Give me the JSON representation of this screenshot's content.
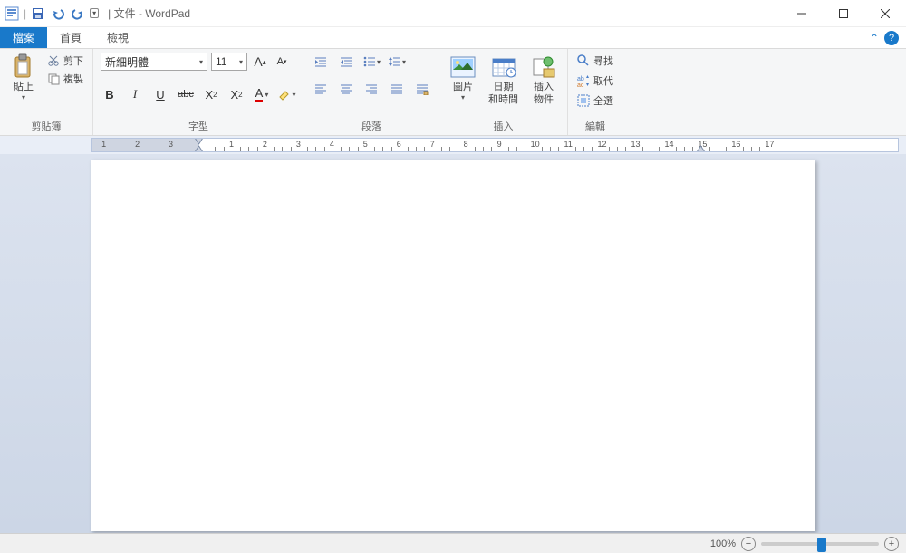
{
  "window": {
    "title": "文件 - WordPad",
    "separator": "|"
  },
  "tabs": {
    "file": "檔案",
    "home": "首頁",
    "view": "檢視"
  },
  "ribbon": {
    "clipboard": {
      "paste": "貼上",
      "cut": "剪下",
      "copy": "複製",
      "label": "剪貼簿"
    },
    "font": {
      "family": "新細明體",
      "size": "11",
      "label": "字型"
    },
    "paragraph": {
      "label": "段落"
    },
    "insert": {
      "picture": "圖片",
      "datetime_line1": "日期",
      "datetime_line2": "和時間",
      "object_line1": "插入",
      "object_line2": "物件",
      "label": "插入"
    },
    "editing": {
      "find": "尋找",
      "replace": "取代",
      "selectall": "全選",
      "label": "編輯"
    }
  },
  "ruler": {
    "pre_labels": [
      "3",
      "2",
      "1"
    ],
    "labels": [
      "1",
      "2",
      "3",
      "4",
      "5",
      "6",
      "7",
      "8",
      "9",
      "10",
      "11",
      "12",
      "13",
      "14",
      "15",
      "16",
      "17"
    ]
  },
  "status": {
    "zoom": "100%"
  }
}
